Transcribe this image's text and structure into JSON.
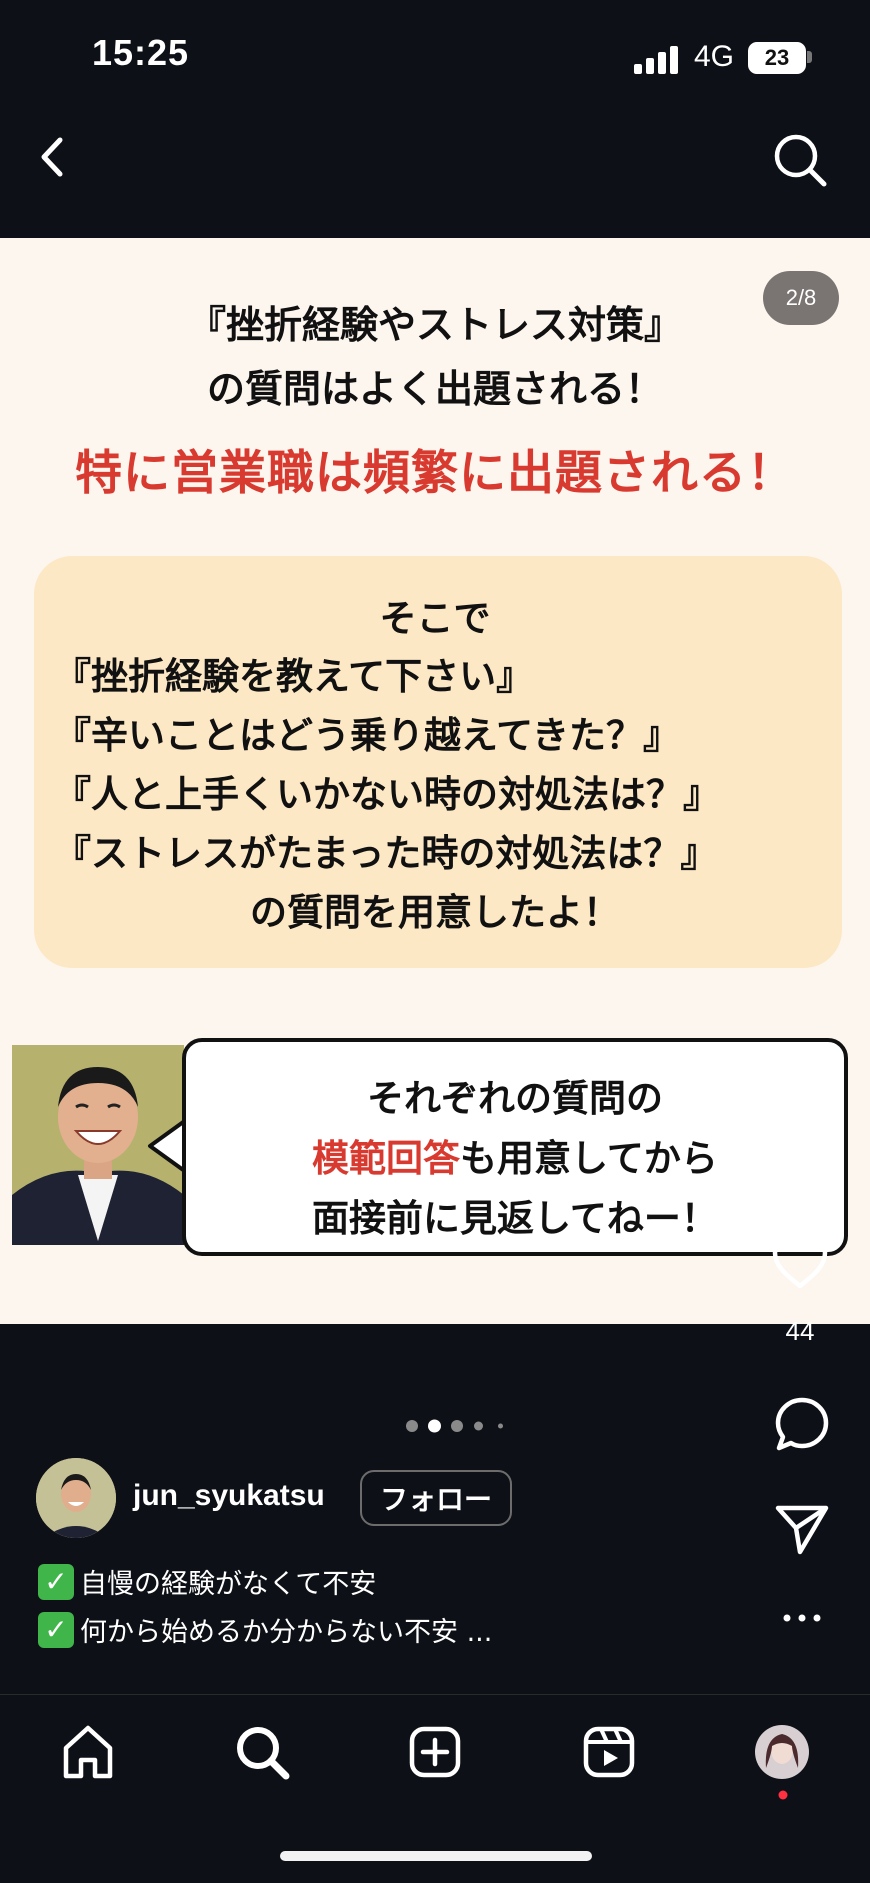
{
  "status_bar": {
    "time": "15:25",
    "network": "4G",
    "battery": "23"
  },
  "post": {
    "page_counter": "2/8",
    "heading_line1": "『挫折経験やストレス対策』",
    "heading_line2": "の質問はよく出題される！",
    "red_heading": "特に営業職は頻繁に出題される！",
    "box_lines": [
      "そこで",
      "『挫折経験を教えて下さい』",
      "『辛いことはどう乗り越えてきた？』",
      "『人と上手くいかない時の対処法は？』",
      "『ストレスがたまった時の対処法は？』",
      "の質問を用意したよ！"
    ],
    "bubble_line1": "それぞれの質問の",
    "bubble_red": "模範回答",
    "bubble_line2_rest": "も用意してから",
    "bubble_line3": "面接前に見返してねー！"
  },
  "actions": {
    "like_count": "44"
  },
  "author": {
    "username": "jun_syukatsu",
    "follow_label": "フォロー"
  },
  "caption": {
    "check_glyph": "✓",
    "lines": [
      "自慢の経験がなくて不安",
      "何から始めるか分からない不安 ..."
    ]
  },
  "colors": {
    "accent_red": "#d93a30",
    "box_fill": "#fde8c6",
    "image_bg": "#fdf6ef",
    "app_bg": "#0d1117"
  },
  "icons": [
    "back-icon",
    "search-icon",
    "heart-icon",
    "comment-icon",
    "send-icon",
    "more-icon",
    "home-icon",
    "create-icon",
    "reels-icon",
    "profile-icon"
  ]
}
